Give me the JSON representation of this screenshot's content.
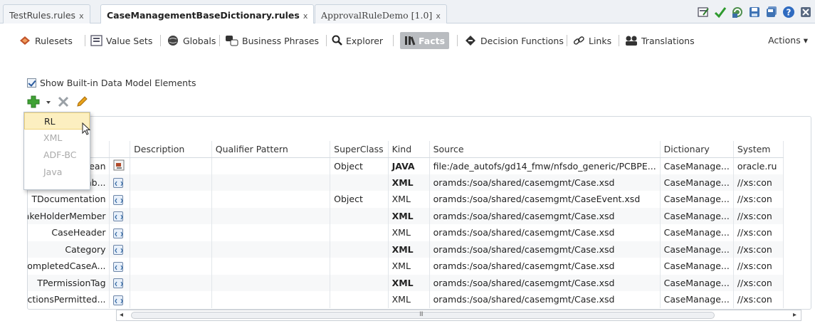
{
  "tabs": [
    {
      "label": "TestRules.rules",
      "close": "x"
    },
    {
      "label": "CaseManagementBaseDictionary.rules",
      "close": "x"
    },
    {
      "label": "ApprovalRuleDemo [1.0]",
      "close": "x"
    }
  ],
  "toolbar_icons": [
    "validate-icon",
    "check-icon",
    "refresh-icon",
    "save-icon",
    "save-all-icon",
    "help-icon",
    "close-window-icon"
  ],
  "nav": {
    "rulesets": "Rulesets",
    "value_sets": "Value Sets",
    "globals": "Globals",
    "business_phrases": "Business Phrases",
    "explorer": "Explorer",
    "facts": "Facts",
    "decision_functions": "Decision Functions",
    "links": "Links",
    "translations": "Translations",
    "actions": "Actions ▾"
  },
  "show_builtin": "Show Built-in Data Model Elements",
  "add_menu": {
    "items": [
      "RL",
      "XML",
      "ADF-BC",
      "Java"
    ],
    "selected": "RL"
  },
  "table": {
    "columns": [
      "",
      "",
      "Description",
      "Qualifier Pattern",
      "SuperClass",
      "Kind",
      "Source",
      "Dictionary",
      "System"
    ],
    "rows": [
      {
        "name": "olean",
        "description": "",
        "qualifier": "",
        "superclass": "Object",
        "kind": "JAVA",
        "source": "file:/ade_autofs/gd14_fmw/nfsdo_generic/PCBPE...",
        "dictionary": "CaseManage...",
        "system": "oracle.ru"
      },
      {
        "name": "mb...",
        "description": "",
        "qualifier": "",
        "superclass": "",
        "kind": "XML",
        "source": "oramds:/soa/shared/casemgmt/Case.xsd",
        "dictionary": "CaseManage...",
        "system": "//xs:con"
      },
      {
        "name": "TDocumentation",
        "description": "",
        "qualifier": "",
        "superclass": "Object",
        "kind": "XML",
        "source": "oramds:/soa/shared/casemgmt/CaseEvent.xsd",
        "dictionary": "CaseManage...",
        "system": "//xs:con"
      },
      {
        "name": "StakeHolderMember",
        "description": "",
        "qualifier": "",
        "superclass": "",
        "kind": "XML",
        "source": "oramds:/soa/shared/casemgmt/Case.xsd",
        "dictionary": "CaseManage...",
        "system": "//xs:con"
      },
      {
        "name": "CaseHeader",
        "description": "",
        "qualifier": "",
        "superclass": "",
        "kind": "XML",
        "source": "oramds:/soa/shared/casemgmt/Case.xsd",
        "dictionary": "CaseManage...",
        "system": "//xs:con"
      },
      {
        "name": "Category",
        "description": "",
        "qualifier": "",
        "superclass": "",
        "kind": "XML",
        "source": "oramds:/soa/shared/casemgmt/Case.xsd",
        "dictionary": "CaseManage...",
        "system": "//xs:con"
      },
      {
        "name": "TCompletedCaseA...",
        "description": "",
        "qualifier": "",
        "superclass": "",
        "kind": "XML",
        "source": "oramds:/soa/shared/casemgmt/Case.xsd",
        "dictionary": "CaseManage...",
        "system": "//xs:con"
      },
      {
        "name": "TPermissionTag",
        "description": "",
        "qualifier": "",
        "superclass": "",
        "kind": "XML",
        "source": "oramds:/soa/shared/casemgmt/Case.xsd",
        "dictionary": "CaseManage...",
        "system": "//xs:con"
      },
      {
        "name": "TActionsPermitted...",
        "description": "",
        "qualifier": "",
        "superclass": "",
        "kind": "XML",
        "source": "oramds:/soa/shared/casemgmt/Case.xsd",
        "dictionary": "CaseManage...",
        "system": "//xs:con"
      }
    ]
  },
  "scrollbar": {
    "left_arrow": "◂",
    "right_arrow": "▸",
    "grip": "III"
  },
  "colors": {
    "accent": "#2a5a9e",
    "active_nav": "#b9bcc0",
    "menu_highlight": "#fcefc0"
  }
}
